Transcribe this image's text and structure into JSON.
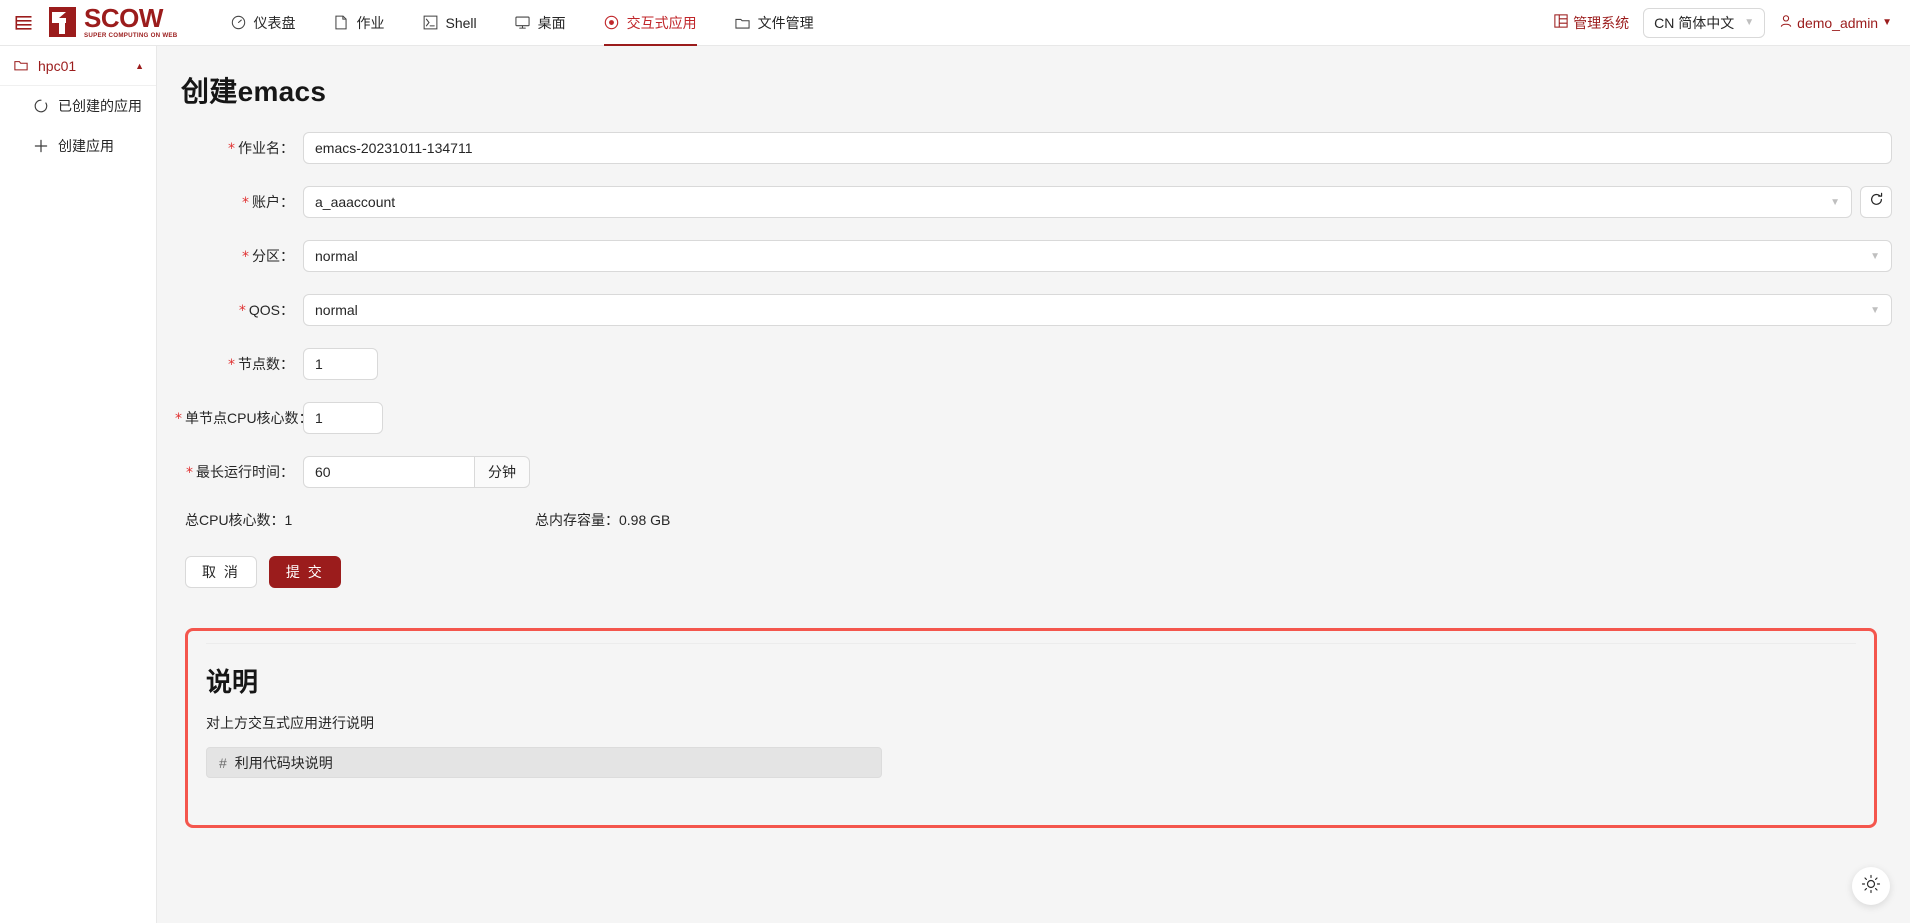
{
  "brand": {
    "name": "SCOW",
    "tagline": "SUPER COMPUTING ON WEB",
    "menu_icon": "menu-fold-icon"
  },
  "nav": {
    "items": [
      {
        "label": "仪表盘",
        "icon": "dashboard-icon",
        "active": false
      },
      {
        "label": "作业",
        "icon": "file-icon",
        "active": false
      },
      {
        "label": "Shell",
        "icon": "terminal-icon",
        "active": false
      },
      {
        "label": "桌面",
        "icon": "desktop-icon",
        "active": false
      },
      {
        "label": "交互式应用",
        "icon": "eye-icon",
        "active": true
      },
      {
        "label": "文件管理",
        "icon": "folder-icon",
        "active": false
      }
    ]
  },
  "header_right": {
    "manage_label": "管理系统",
    "manage_icon": "layout-icon",
    "language_value": "CN 简体中文",
    "language_caret": "chevron-down-icon",
    "user_name": "demo_admin",
    "user_icon": "user-icon",
    "user_caret": "chevron-down-icon"
  },
  "sidebar": {
    "cluster": {
      "label": "hpc01",
      "icon": "folder-icon",
      "caret": "chevron-up-icon"
    },
    "items": [
      {
        "label": "已创建的应用",
        "icon": "loading-circle-icon"
      },
      {
        "label": "创建应用",
        "icon": "plus-icon"
      }
    ]
  },
  "main": {
    "title": "创建emacs",
    "form": {
      "job_name": {
        "label": "作业名",
        "required": true,
        "value": "emacs-20231011-134711",
        "placeholder": ""
      },
      "account": {
        "label": "账户",
        "required": true,
        "value": "a_aaaccount",
        "caret": "chevron-down-icon",
        "refresh_icon": "reload-icon"
      },
      "partition": {
        "label": "分区",
        "required": true,
        "value": "normal",
        "caret": "chevron-down-icon"
      },
      "qos": {
        "label": "QOS",
        "required": true,
        "value": "normal",
        "caret": "chevron-down-icon"
      },
      "node_count": {
        "label": "节点数",
        "required": true,
        "value": "1"
      },
      "cpu_per_node": {
        "label": "单节点CPU核心数",
        "required": true,
        "value": "1"
      },
      "max_runtime": {
        "label": "最长运行时间",
        "required": true,
        "value": "60",
        "unit": "分钟"
      }
    },
    "summary": {
      "total_cpu": "总CPU核心数：1",
      "total_memory": "总内存容量：0.98 GB"
    },
    "buttons": {
      "cancel": "取 消",
      "submit": "提 交"
    },
    "description_card": {
      "title": "说明",
      "text": "对上方交互式应用进行说明",
      "code_hash": "#",
      "code_text": "利用代码块说明",
      "highlight_color": "#f4564d"
    },
    "theme_toggle_icon": "sun-icon"
  },
  "colors": {
    "brand_red": "#9b1c1c",
    "active_red": "#c0262a",
    "highlight_red": "#f4564d",
    "content_bg": "#f5f5f5",
    "border": "#d9d9d9"
  }
}
